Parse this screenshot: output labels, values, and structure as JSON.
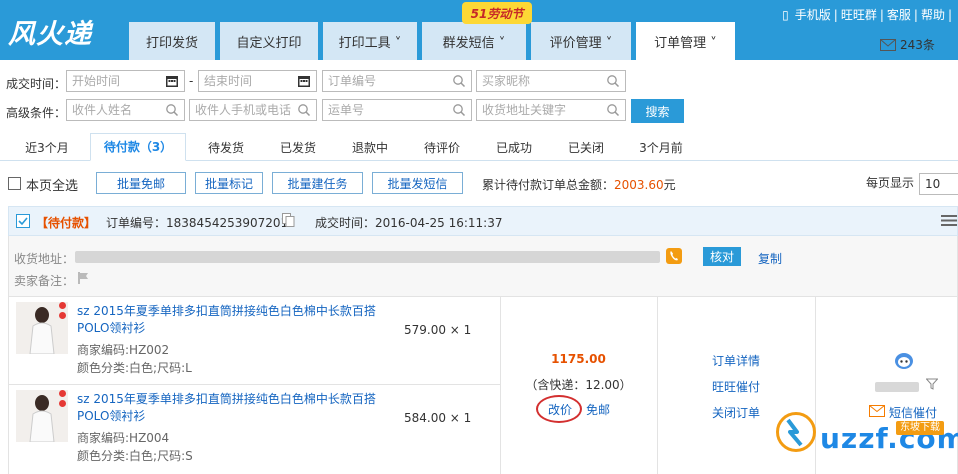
{
  "app": {
    "logo": "风火递",
    "promo": "51劳动节"
  },
  "top_links": [
    "手机版",
    "旺旺群",
    "客服",
    "帮助"
  ],
  "messages": {
    "count": "243条"
  },
  "nav": [
    {
      "label": "打印发货"
    },
    {
      "label": "自定义打印"
    },
    {
      "label": "打印工具 ˅"
    },
    {
      "label": "群发短信 ˅"
    },
    {
      "label": "评价管理 ˅"
    },
    {
      "label": "订单管理 ˅"
    }
  ],
  "filters": {
    "trade_time_label": "成交时间：",
    "advanced_label": "高级条件：",
    "start_placeholder": "开始时间",
    "end_placeholder": "结束时间",
    "dash": "-",
    "order_no_placeholder": "订单编号",
    "buyer_placeholder": "买家昵称",
    "receiver_name_placeholder": "收件人姓名",
    "receiver_phone_placeholder": "收件人手机或电话",
    "waybill_placeholder": "运单号",
    "address_placeholder": "收货地址关键字",
    "search_label": "搜索"
  },
  "status_tabs": [
    {
      "label": "近3个月"
    },
    {
      "label": "待付款（3）"
    },
    {
      "label": "待发货"
    },
    {
      "label": "已发货"
    },
    {
      "label": "退款中"
    },
    {
      "label": "待评价"
    },
    {
      "label": "已成功"
    },
    {
      "label": "已关闭"
    },
    {
      "label": "3个月前"
    }
  ],
  "actions": {
    "select_all": "本页全选",
    "batch_free_shipping": "批量免邮",
    "batch_mark": "批量标记",
    "batch_task": "批量建任务",
    "batch_sms": "批量发短信",
    "total_label": "累计待付款订单总金额：",
    "total_amount": "2003.60",
    "total_unit": "元",
    "per_page_label": "每页显示",
    "per_page_value": "10"
  },
  "order": {
    "status": "【待付款】",
    "order_no_label": "订单编号：",
    "order_no": "1838454253907201",
    "time_label": "成交时间：",
    "time": "2016-04-25 16:11:37",
    "address_label": "收货地址：",
    "seller_note_label": "卖家备注：",
    "verify_label": "核对",
    "copy_label": "复制",
    "total": "1175.00",
    "shipping": "（含快递：12.00）",
    "change_price": "改价",
    "free_shipping": "免邮",
    "detail_link": "订单详情",
    "wangwang_link": "旺旺催付",
    "close_link": "关闭订单",
    "sms_remind": "短信催付",
    "items": [
      {
        "title": "sz 2015年夏季单排多扣直筒拼接纯色白色棉中长款百搭POLO领衬衫",
        "code": "商家编码:HZ002",
        "sku": "颜色分类:白色;尺码:L",
        "price": "579.00 × 1"
      },
      {
        "title": "sz 2015年夏季单排多扣直筒拼接纯色白色棉中长款百搭POLO领衬衫",
        "code": "商家编码:HZ004",
        "sku": "颜色分类:白色;尺码:S",
        "price": "584.00 × 1"
      }
    ]
  },
  "watermark": {
    "text": "uzzf.com",
    "badge": "东坡下载"
  }
}
